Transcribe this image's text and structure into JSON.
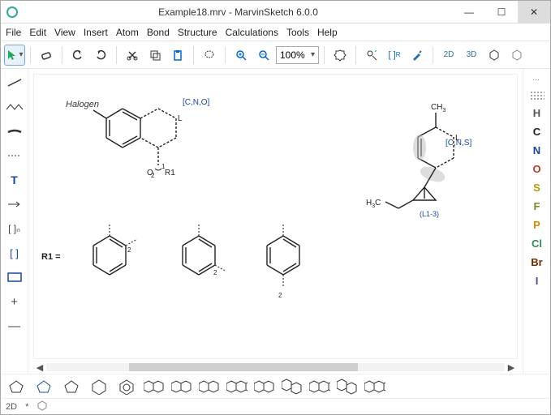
{
  "window": {
    "title": "Example18.mrv - MarvinSketch 6.0.0"
  },
  "menu": {
    "items": [
      "File",
      "Edit",
      "View",
      "Insert",
      "Atom",
      "Bond",
      "Structure",
      "Calculations",
      "Tools",
      "Help"
    ]
  },
  "toolbar": {
    "zoom_value": "100%",
    "labels": {
      "2d": "2D",
      "3d": "3D"
    }
  },
  "right_elements": [
    {
      "sym": "H",
      "color": "#555"
    },
    {
      "sym": "C",
      "color": "#222"
    },
    {
      "sym": "N",
      "color": "#1846a0"
    },
    {
      "sym": "O",
      "color": "#c0392b"
    },
    {
      "sym": "S",
      "color": "#b59a00"
    },
    {
      "sym": "F",
      "color": "#7a8a2a"
    },
    {
      "sym": "P",
      "color": "#d48f00"
    },
    {
      "sym": "Cl",
      "color": "#2e8b57"
    },
    {
      "sym": "Br",
      "color": "#6e2c00"
    },
    {
      "sym": "I",
      "color": "#5d3fa3"
    }
  ],
  "left_tools": {
    "t_label": "T",
    "brackets_n": "[ ]ₙ",
    "brackets": "[ ]"
  },
  "canvas": {
    "halogen_label": "Halogen",
    "atomlist1": "[C,N,O]",
    "atomlist2": "[C,N,S]",
    "link_label": "(L1-3)",
    "ch3_a": "CH",
    "ch3_a_sub": "3",
    "ch3_b": "H",
    "ch3_b_sub": "3",
    "ch3_b_tail": "C",
    "l_label": "L",
    "r1_label": "R1",
    "r1_eq": "R1 =",
    "o_label": "O",
    "num1": "1",
    "num2": "2",
    "num2b": "2",
    "num2c": "2"
  },
  "status": {
    "mode": "2D",
    "star": "*"
  },
  "chart_data": {
    "type": "diagram",
    "note": "Chemical structure sketch; no numeric chart data",
    "structures": [
      {
        "id": "query-top-left",
        "features": [
          "benzene-fused-6ring",
          "Halogen substituent",
          "atom-list [C,N,O]",
          "L label",
          "attachment O",
          "R-group R1"
        ]
      },
      {
        "id": "query-top-right",
        "features": [
          "6-ring with dashed bonds",
          "CH3 substituent",
          "atom-list [C,N,S]",
          "L label",
          "cyclopropane fused",
          "link-node (L1-3)",
          "H3C substituent"
        ]
      },
      {
        "id": "R1-members",
        "count": 3,
        "pattern": "ortho/meta/para disubstituted benzene with wavy attachment bonds"
      }
    ]
  }
}
